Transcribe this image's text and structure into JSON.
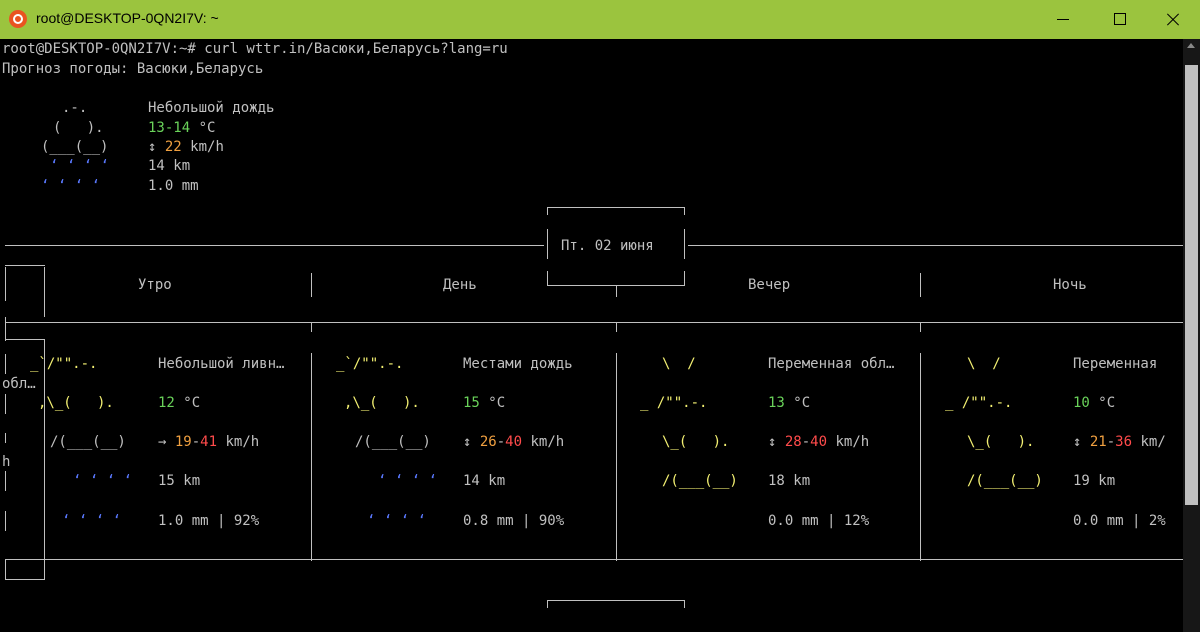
{
  "window": {
    "title": "root@DESKTOP-0QN2I7V: ~"
  },
  "terminal": {
    "prompt": "root@DESKTOP-0QN2I7V:~# curl wttr.in/Васюки,Беларусь?lang=ru",
    "forecast_title": "Прогноз погоды: Васюки,Беларусь",
    "current": {
      "art": [
        ".-.",
        "(   ).",
        "(___(__)",
        "‘ ‘ ‘ ‘",
        "‘ ‘ ‘ ‘"
      ],
      "condition": "Небольшой дождь",
      "temp": "13-14",
      "temp_unit": " °C",
      "wind_icon": "↕",
      "wind_speed": "22",
      "wind_unit": " km/h",
      "visibility": "14 km",
      "precip": "1.0 mm"
    },
    "day_label": "Пт. 02 июня",
    "periods": [
      {
        "name": "Утро",
        "art": [
          "_`/\"\".-.",
          ",\\_(   ).",
          "/(___(__)",
          "‘ ‘ ‘ ‘",
          "‘ ‘ ‘ ‘"
        ],
        "condition": "Небольшой ливн…",
        "temp": "12",
        "temp_unit": " °C",
        "wind_icon": "→",
        "wind_low": "19",
        "wind_dash": "-",
        "wind_high": "41",
        "wind_unit": " km/h",
        "visibility": "15 km",
        "precip": "1.0 mm | 92%"
      },
      {
        "name": "День",
        "art": [
          "_`/\"\".-.",
          ",\\_(   ).",
          "/(___(__)",
          "‘ ‘ ‘ ‘",
          "‘ ‘ ‘ ‘"
        ],
        "condition": "Местами дождь",
        "temp": "15",
        "temp_unit": " °C",
        "wind_icon": "↕",
        "wind_low": "26",
        "wind_dash": "-",
        "wind_high": "40",
        "wind_unit": " km/h",
        "visibility": "14 km",
        "precip": "0.8 mm | 90%"
      },
      {
        "name": "Вечер",
        "art": [
          "\\  /",
          "_ /\"\".-.",
          "\\_(   ).",
          "/(___(__)",
          ""
        ],
        "condition": "Переменная обл…",
        "temp": "13",
        "temp_unit": " °C",
        "wind_icon": "↕",
        "wind_low": "28",
        "wind_dash": "-",
        "wind_high": "40",
        "wind_unit": " km/h",
        "visibility": "18 km",
        "precip": "0.0 mm | 12%"
      },
      {
        "name": "Ночь",
        "art": [
          "\\  /",
          "_ /\"\".-.",
          "\\_(   ).",
          "/(___(__)",
          ""
        ],
        "condition": "Переменная",
        "temp": "10",
        "temp_unit": " °C",
        "wind_icon": "↕",
        "wind_low": "21",
        "wind_dash": "-",
        "wind_high": "36",
        "wind_unit": " km/",
        "visibility": "19 km",
        "precip": "0.0 mm | 2%"
      }
    ],
    "wrap_cond": "обл…",
    "wrap_wind": "h"
  }
}
